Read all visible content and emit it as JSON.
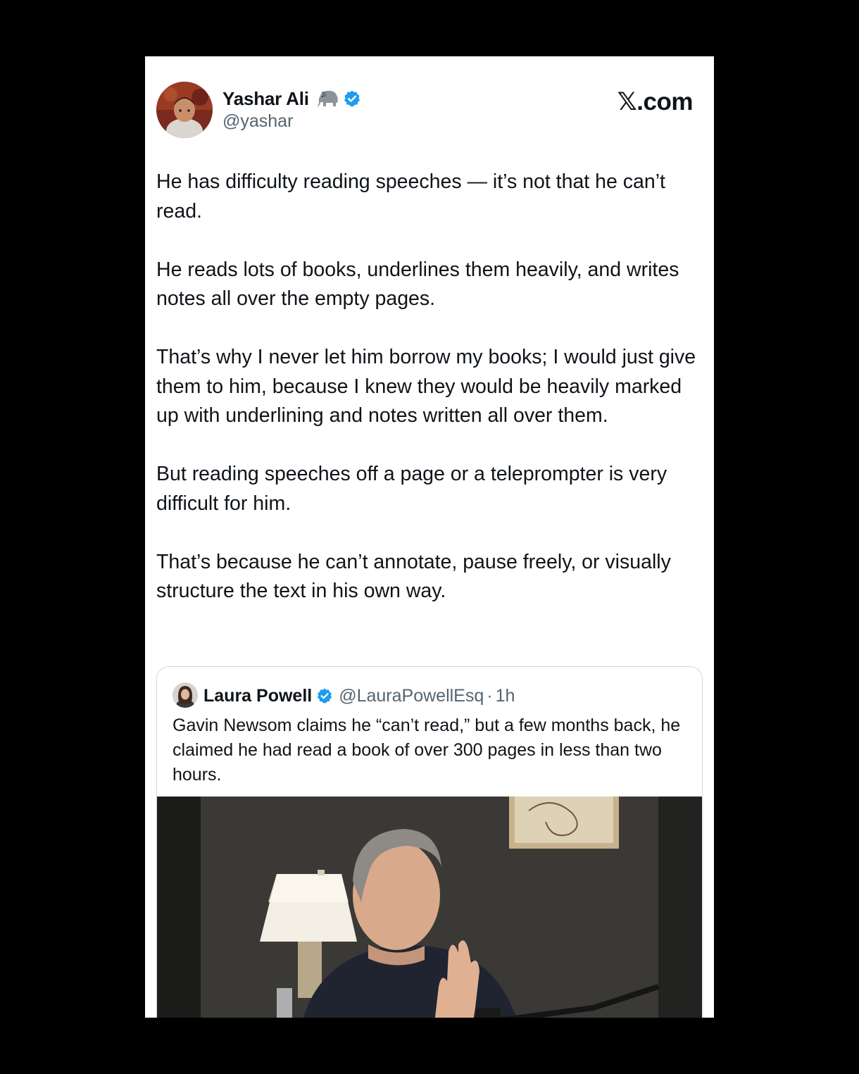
{
  "tweet": {
    "author_name": "Yashar Ali",
    "author_handle": "@yashar",
    "author_emoji": "elephant-emoji",
    "verified": "verified-badge-icon",
    "brand": "𝕏.com",
    "paragraphs": [
      "He has difficulty reading speeches — it’s not that he can’t read.",
      "He reads lots of books, underlines them heavily, and writes notes all over the empty pages.",
      "That’s why I never let him borrow my books; I would just give them to him, because I knew they would be heavily marked up with underlining and notes written all over them.",
      "But reading speeches off a page or a teleprompter is very difficult for him.",
      "That’s because he can’t annotate, pause freely, or visually structure the text in his own way."
    ]
  },
  "quoted": {
    "author_name": "Laura Powell",
    "author_handle": "@LauraPowellEsq",
    "separator": "·",
    "time": "1h",
    "text": "Gavin Newsom claims he “can’t read,” but a few months back, he claimed he had read a book of over 300 pages in less than two hours.",
    "media": "video-thumbnail"
  },
  "colors": {
    "background": "#000000",
    "card": "#ffffff",
    "text_primary": "#0f1419",
    "text_secondary": "#536471",
    "verified_blue": "#1d9bf0",
    "border": "#cfd9de"
  }
}
